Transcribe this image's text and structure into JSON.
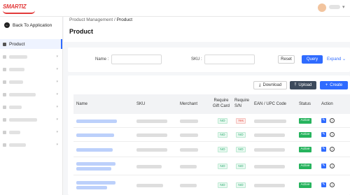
{
  "brand": {
    "logo_text": "SMARTIZ",
    "accent": "#2f6bff",
    "logo_color": "#e23b3b"
  },
  "sidebar": {
    "back_label": "Back To Application",
    "active_item": "Product"
  },
  "breadcrumb": {
    "parent": "Product Management",
    "separator": "/",
    "current": "Product"
  },
  "page": {
    "title": "Product"
  },
  "filters": {
    "name_label": "Name :",
    "sku_label": "SKU :",
    "reset_label": "Reset",
    "query_label": "Query",
    "expand_label": "Expand"
  },
  "toolbar": {
    "download_label": "Download",
    "upload_label": "Upload",
    "create_label": "Create"
  },
  "table": {
    "headers": {
      "name": "Name",
      "sku": "SKU",
      "merchant": "Merchant",
      "require_gift_card": "Require Gift Card",
      "require_sn": "Require S/N",
      "ean": "EAN / UPC Code",
      "status": "Status",
      "action": "Action"
    },
    "rows": [
      {
        "gift_card": "NO",
        "sn": "Yes",
        "status": "Active"
      },
      {
        "gift_card": "NO",
        "sn": "NO",
        "status": "Active"
      },
      {
        "gift_card": "NO",
        "sn": "NO",
        "status": "Active"
      },
      {
        "gift_card": "NO",
        "sn": "NO",
        "status": "Active"
      },
      {
        "gift_card": "NO",
        "sn": "NO",
        "status": "Active"
      }
    ]
  }
}
